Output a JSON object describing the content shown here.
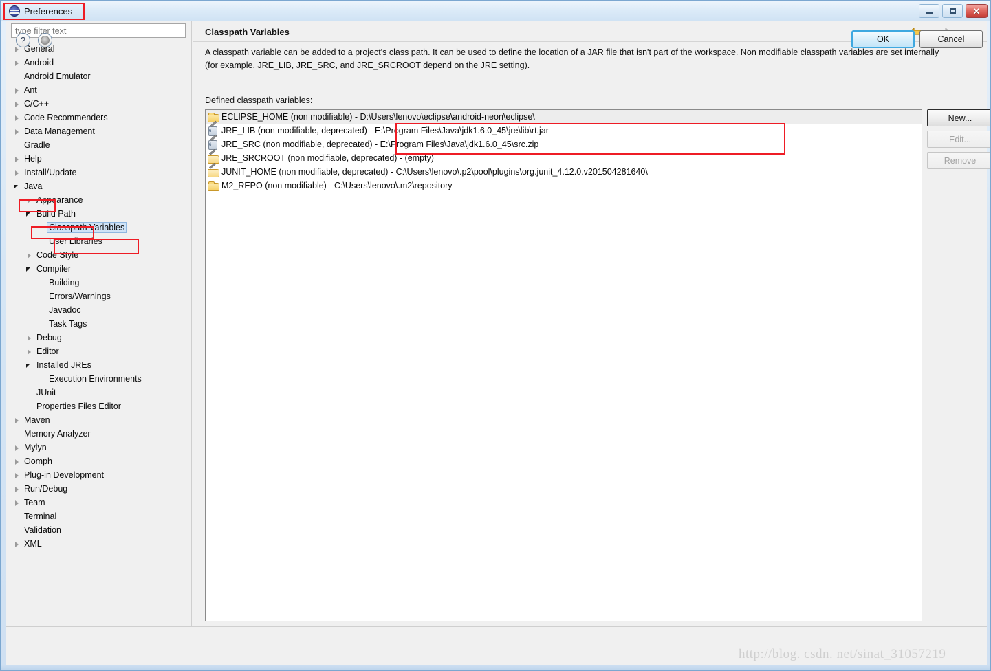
{
  "window": {
    "title": "Preferences",
    "icon": "eclipse-icon",
    "buttons": {
      "minimize": "minimize-icon",
      "maximize": "maximize-icon",
      "close": "✕"
    }
  },
  "colors": {
    "annotation": "#ee1c25",
    "selection": "#cfe3f7",
    "accent": "#3fa8e0",
    "titlebar": "#dcebf8"
  },
  "sidebar": {
    "filter": {
      "placeholder": "type filter text",
      "value": ""
    },
    "items": [
      {
        "label": "General",
        "indent": 0,
        "state": "collapsed",
        "selected": false
      },
      {
        "label": "Android",
        "indent": 0,
        "state": "collapsed",
        "selected": false
      },
      {
        "label": "Android Emulator",
        "indent": 0,
        "state": "leaf",
        "selected": false
      },
      {
        "label": "Ant",
        "indent": 0,
        "state": "collapsed",
        "selected": false
      },
      {
        "label": "C/C++",
        "indent": 0,
        "state": "collapsed",
        "selected": false
      },
      {
        "label": "Code Recommenders",
        "indent": 0,
        "state": "collapsed",
        "selected": false
      },
      {
        "label": "Data Management",
        "indent": 0,
        "state": "collapsed",
        "selected": false
      },
      {
        "label": "Gradle",
        "indent": 0,
        "state": "leaf",
        "selected": false
      },
      {
        "label": "Help",
        "indent": 0,
        "state": "collapsed",
        "selected": false
      },
      {
        "label": "Install/Update",
        "indent": 0,
        "state": "collapsed",
        "selected": false
      },
      {
        "label": "Java",
        "indent": 0,
        "state": "expanded",
        "selected": false
      },
      {
        "label": "Appearance",
        "indent": 1,
        "state": "collapsed",
        "selected": false
      },
      {
        "label": "Build Path",
        "indent": 1,
        "state": "expanded",
        "selected": false
      },
      {
        "label": "Classpath Variables",
        "indent": 2,
        "state": "leaf",
        "selected": true
      },
      {
        "label": "User Libraries",
        "indent": 2,
        "state": "leaf",
        "selected": false
      },
      {
        "label": "Code Style",
        "indent": 1,
        "state": "collapsed",
        "selected": false
      },
      {
        "label": "Compiler",
        "indent": 1,
        "state": "expanded",
        "selected": false
      },
      {
        "label": "Building",
        "indent": 2,
        "state": "leaf",
        "selected": false
      },
      {
        "label": "Errors/Warnings",
        "indent": 2,
        "state": "leaf",
        "selected": false
      },
      {
        "label": "Javadoc",
        "indent": 2,
        "state": "leaf",
        "selected": false
      },
      {
        "label": "Task Tags",
        "indent": 2,
        "state": "leaf",
        "selected": false
      },
      {
        "label": "Debug",
        "indent": 1,
        "state": "collapsed",
        "selected": false
      },
      {
        "label": "Editor",
        "indent": 1,
        "state": "collapsed",
        "selected": false
      },
      {
        "label": "Installed JREs",
        "indent": 1,
        "state": "expanded",
        "selected": false
      },
      {
        "label": "Execution Environments",
        "indent": 2,
        "state": "leaf",
        "selected": false
      },
      {
        "label": "JUnit",
        "indent": 1,
        "state": "leaf",
        "selected": false
      },
      {
        "label": "Properties Files Editor",
        "indent": 1,
        "state": "leaf",
        "selected": false
      },
      {
        "label": "Maven",
        "indent": 0,
        "state": "collapsed",
        "selected": false
      },
      {
        "label": "Memory Analyzer",
        "indent": 0,
        "state": "leaf",
        "selected": false
      },
      {
        "label": "Mylyn",
        "indent": 0,
        "state": "collapsed",
        "selected": false
      },
      {
        "label": "Oomph",
        "indent": 0,
        "state": "collapsed",
        "selected": false
      },
      {
        "label": "Plug-in Development",
        "indent": 0,
        "state": "collapsed",
        "selected": false
      },
      {
        "label": "Run/Debug",
        "indent": 0,
        "state": "collapsed",
        "selected": false
      },
      {
        "label": "Team",
        "indent": 0,
        "state": "collapsed",
        "selected": false
      },
      {
        "label": "Terminal",
        "indent": 0,
        "state": "leaf",
        "selected": false
      },
      {
        "label": "Validation",
        "indent": 0,
        "state": "leaf",
        "selected": false
      },
      {
        "label": "XML",
        "indent": 0,
        "state": "collapsed",
        "selected": false
      }
    ]
  },
  "page": {
    "title": "Classpath Variables",
    "description_line1": "A classpath variable can be added to a project's class path. It can be used to define the location of a JAR file that isn't part of the workspace. Non modifiable classpath variables are set internally",
    "description_line2": "(for example, JRE_LIB, JRE_SRC, and JRE_SRCROOT depend on the JRE setting).",
    "defined_label": "Defined classpath variables:",
    "nav": {
      "back_icon": "back-arrow-icon",
      "back_caret": "chevron-down-icon",
      "forward_icon": "forward-arrow-icon",
      "forward_caret": "chevron-down-icon",
      "menu_caret": "chevron-down-icon"
    },
    "variables": [
      {
        "icon": "folder-icon",
        "text": "ECLIPSE_HOME (non modifiable) - D:\\Users\\lenovo\\eclipse\\android-neon\\eclipse\\",
        "selected": true
      },
      {
        "icon": "jar-icon",
        "text": "JRE_LIB (non modifiable, deprecated) - E:\\Program Files\\Java\\jdk1.6.0_45\\jre\\lib\\rt.jar",
        "selected": false
      },
      {
        "icon": "jar-icon",
        "text": "JRE_SRC (non modifiable, deprecated) - E:\\Program Files\\Java\\jdk1.6.0_45\\src.zip",
        "selected": false
      },
      {
        "icon": "folder-pencil-icon",
        "text": "JRE_SRCROOT (non modifiable, deprecated) - (empty)",
        "selected": false
      },
      {
        "icon": "folder-pencil-icon",
        "text": "JUNIT_HOME (non modifiable, deprecated) - C:\\Users\\lenovo\\.p2\\pool\\plugins\\org.junit_4.12.0.v201504281640\\",
        "selected": false
      },
      {
        "icon": "folder-icon",
        "text": "M2_REPO (non modifiable) - C:\\Users\\lenovo\\.m2\\repository",
        "selected": false
      }
    ],
    "side_buttons": [
      {
        "label": "New...",
        "enabled": true
      },
      {
        "label": "Edit...",
        "enabled": false
      },
      {
        "label": "Remove",
        "enabled": false
      }
    ]
  },
  "footer": {
    "help_icon": "?",
    "apply_icon": "apply-icon",
    "ok_label": "OK",
    "cancel_label": "Cancel"
  },
  "watermark": "http://blog. csdn. net/sinat_31057219"
}
